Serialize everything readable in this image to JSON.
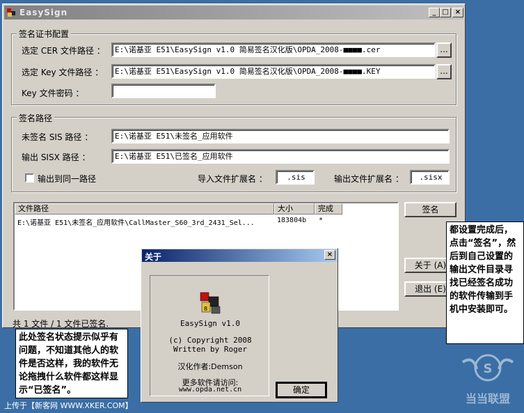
{
  "window": {
    "title": "EasySign",
    "controls": [
      "_",
      "□",
      "×"
    ]
  },
  "cert_group": {
    "title": "签名证书配置",
    "cer_label": "选定 CER 文件路径 ：",
    "cer_value": "E:\\诺基亚 E51\\EasySign v1.0 简易签名汉化版\\OPDA_2008-■■■■.cer",
    "key_label": "选定 Key 文件路径 ：",
    "key_value": "E:\\诺基亚 E51\\EasySign v1.0 简易签名汉化版\\OPDA_2008-■■■■.KEY",
    "password_label": "Key 文件密码 ：",
    "password_value": "",
    "browse_label": "..."
  },
  "path_group": {
    "title": "签名路径",
    "unsigned_label": "未签名 SIS 路径 ：",
    "unsigned_value": "E:\\诺基亚 E51\\未签名_应用软件",
    "output_label": "输出 SISX 路径 ：",
    "output_value": "E:\\诺基亚 E51\\已签名_应用软件",
    "same_path_label": "输出到同一路径",
    "import_ext_label": "导入文件扩展名 ：",
    "import_ext_value": ".sis",
    "output_ext_label": "输出文件扩展名 ：",
    "output_ext_value": ".sisx"
  },
  "file_list": {
    "columns": [
      "文件路径",
      "大小",
      "完成"
    ],
    "rows": [
      {
        "path": "E:\\诺基亚 E51\\未签名_应用软件\\CallMaster_S60_3rd_2431_Sel...",
        "size": "183804b",
        "done": "*"
      }
    ]
  },
  "buttons": {
    "sign": "签名",
    "about": "关于 (A)",
    "exit": "退出 (E)"
  },
  "status": "共 1 文件 / 1 文件已签名.",
  "about_dialog": {
    "title": "关于",
    "app_name": "EasySign v1.0",
    "copyright": "(c) Copyright 2008",
    "author": "Written by Roger",
    "translator": "汉化作者:Demson",
    "more_label": "更多软件请访问:",
    "url": "www.opda.net.cn",
    "ok": "确定"
  },
  "annotations": {
    "right": "都设置完成后，点击“签名”，然后到自己设置的输出文件目录寻找已经签名成功的软件传输到手机中安装即可。",
    "left": "此处签名状态提示似乎有问题，不知道其他人的软件是否这样，我的软件无论拖拽什么软件都这样显示“已签名”。"
  },
  "footer_upload": "上传于【新客网 WWW.XKER.COM】",
  "watermark_text": "当当联盟",
  "colors": {
    "desktop": "#3a6ea5",
    "window_face": "#d4d0c8",
    "dialog_title": "#0a246a"
  }
}
